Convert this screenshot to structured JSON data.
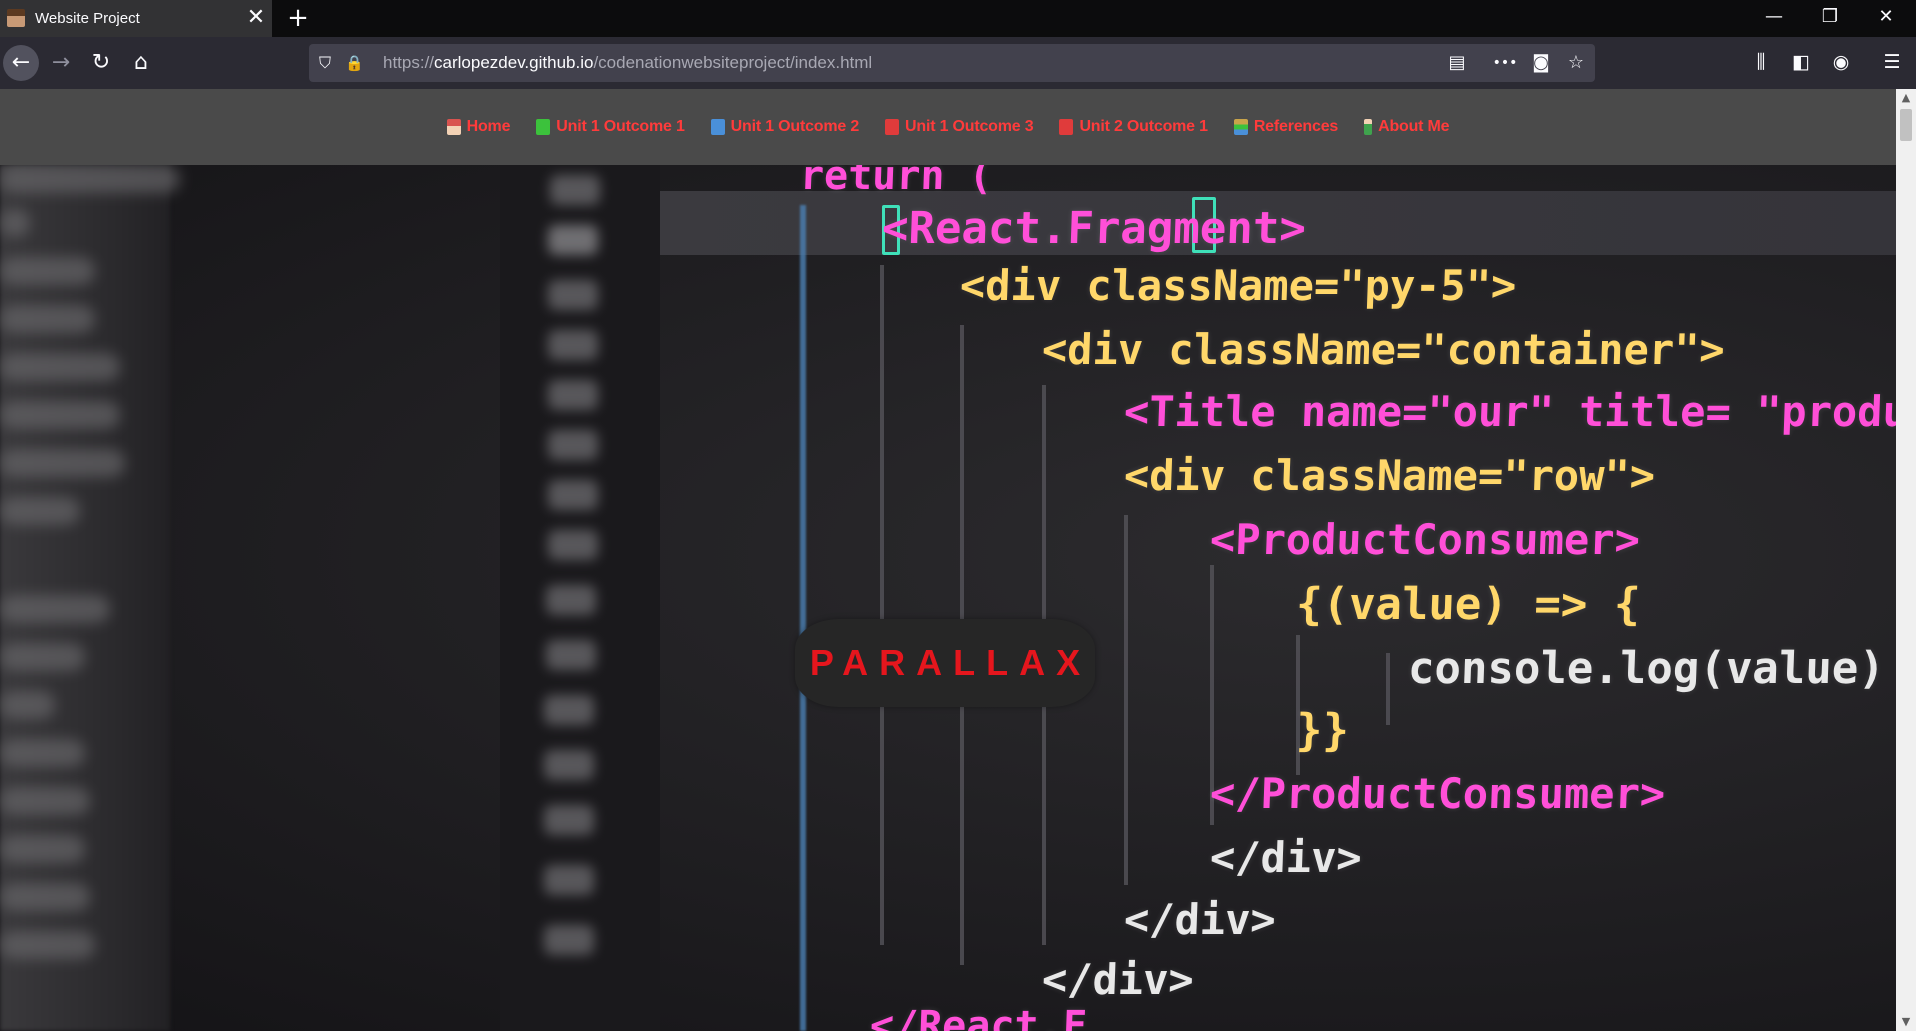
{
  "browser": {
    "tab": {
      "title": "Website Project",
      "close_glyph": "✕",
      "favicon": "profile-favicon"
    },
    "new_tab_glyph": "+",
    "window_controls": {
      "minimize": "—",
      "restore": "❐",
      "close": "✕"
    },
    "nav": {
      "back": "←",
      "forward": "→",
      "reload": "↻",
      "home": "⌂"
    },
    "url": {
      "prefix": "https://",
      "domain": "carlopezdev.github.io",
      "path": "/codenationwebsiteproject/index.html"
    },
    "url_icons": {
      "shield": "⛉",
      "lock": "🔒",
      "reader": "▤",
      "more": "•••",
      "pocket": "◙",
      "bookmark": "☆"
    },
    "toolbar_icons": {
      "library": "⫼",
      "sidebar": "◧",
      "account": "◉",
      "menu": "☰"
    }
  },
  "site_nav": {
    "items": [
      {
        "label": "Home",
        "icon": "house-icon",
        "color": "#d9534f"
      },
      {
        "label": "Unit 1 Outcome 1",
        "icon": "green-book-icon",
        "color": "#3cc23c"
      },
      {
        "label": "Unit 1 Outcome 2",
        "icon": "blue-book-icon",
        "color": "#4a90d9"
      },
      {
        "label": "Unit 1 Outcome 3",
        "icon": "red-book-icon",
        "color": "#e03b3b"
      },
      {
        "label": "Unit 2 Outcome 1",
        "icon": "red-book-icon",
        "color": "#e03b3b"
      },
      {
        "label": "References",
        "icon": "books-icon",
        "color": "#c9a44a"
      },
      {
        "label": "About Me",
        "icon": "person-icon",
        "color": "#3fa34d"
      }
    ],
    "link_color": "#ff3b3b"
  },
  "hero": {
    "title": "PARALLAX",
    "code_lines": [
      "return (",
      "<React.Fragment>",
      "<div className=\"py-5\">",
      "<div className=\"container\">",
      "<Title name=\"our\" title= \"product",
      "<div className=\"row\">",
      "<ProductConsumer>",
      "{(value) => {",
      "console.log(value)",
      "}}",
      "</ProductConsumer>",
      "</div>",
      "</div>",
      "</div>",
      "</React.F"
    ]
  }
}
